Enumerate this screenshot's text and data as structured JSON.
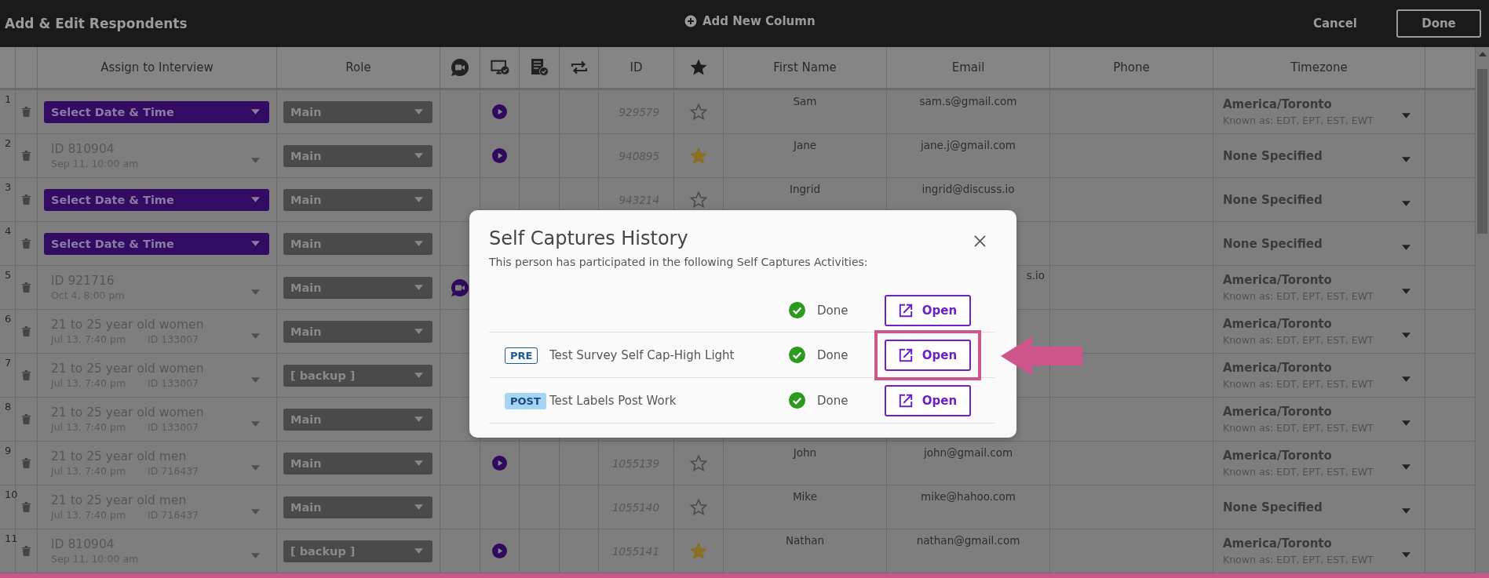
{
  "header": {
    "title": "Add & Edit Respondents",
    "add_column": "Add New Column",
    "cancel": "Cancel",
    "done": "Done"
  },
  "columns": [
    "Assign to Interview",
    "Role",
    "ID",
    "First Name",
    "Email",
    "Phone",
    "Timezone"
  ],
  "rows": [
    {
      "number": "1",
      "assign": {
        "kind": "select",
        "label": "Select Date & Time"
      },
      "role": "Main",
      "play": true,
      "id": "929579",
      "starred": false,
      "first_name": "Sam",
      "email": "sam.s@gmail.com",
      "timezone": {
        "name": "America/Toronto",
        "known_as": "Known as: EDT, EPT, EST, EWT"
      }
    },
    {
      "number": "2",
      "assign": {
        "kind": "assigned",
        "title": "ID 810904",
        "date": "Sep 11, 10:00 am"
      },
      "role": "Main",
      "play": true,
      "id": "940895",
      "starred": true,
      "first_name": "Jane",
      "email": "jane.j@gmail.com",
      "timezone": {
        "name": "None Specified"
      }
    },
    {
      "number": "3",
      "assign": {
        "kind": "select",
        "label": "Select Date & Time"
      },
      "role": "Main",
      "play": false,
      "id": "943214",
      "starred": false,
      "first_name": "Ingrid",
      "email": "ingrid@discuss.io",
      "timezone": {
        "name": "None Specified"
      }
    },
    {
      "number": "4",
      "assign": {
        "kind": "select",
        "label": "Select Date & Time"
      },
      "role": "Main",
      "play": false,
      "timezone": {
        "name": "None Specified"
      }
    },
    {
      "number": "5",
      "assign": {
        "kind": "assigned",
        "title": "ID 921716",
        "date": "Oct 4, 8:00 pm"
      },
      "role": "Main",
      "chat": true,
      "email": "s.io",
      "email_cut": true,
      "timezone": {
        "name": "America/Toronto",
        "known_as": "Known as: EDT, EPT, EST, EWT"
      }
    },
    {
      "number": "6",
      "assign": {
        "kind": "assigned",
        "title": "21 to 25 year old women",
        "date": "Jul 13, 7:40 pm",
        "ref": "ID 133007"
      },
      "role": "Main",
      "timezone": {
        "name": "America/Toronto",
        "known_as": "Known as: EDT, EPT, EST, EWT"
      }
    },
    {
      "number": "7",
      "assign": {
        "kind": "assigned",
        "title": "21 to 25 year old women",
        "date": "Jul 13, 7:40 pm",
        "ref": "ID 133007"
      },
      "role": "[ backup ]",
      "timezone": {
        "name": "America/Toronto",
        "known_as": "Known as: EDT, EPT, EST, EWT"
      }
    },
    {
      "number": "8",
      "assign": {
        "kind": "assigned",
        "title": "21 to 25 year old women",
        "date": "Jul 13, 7:40 pm",
        "ref": "ID 133007"
      },
      "role": "Main",
      "timezone": {
        "name": "America/Toronto",
        "known_as": "Known as: EDT, EPT, EST, EWT"
      }
    },
    {
      "number": "9",
      "assign": {
        "kind": "assigned",
        "title": "21 to 25 year old men",
        "date": "Jul 13, 7:40 pm",
        "ref": "ID 716437"
      },
      "role": "Main",
      "play": true,
      "id": "1055139",
      "starred": false,
      "first_name": "John",
      "email": "john@gmail.com",
      "timezone": {
        "name": "America/Toronto",
        "known_as": "Known as: EDT, EPT, EST, EWT"
      }
    },
    {
      "number": "10",
      "assign": {
        "kind": "assigned",
        "title": "21 to 25 year old men",
        "date": "Jul 13, 7:40 pm",
        "ref": "ID 716437"
      },
      "role": "Main",
      "play": false,
      "id": "1055140",
      "starred": false,
      "first_name": "Mike",
      "email": "mike@hahoo.com",
      "timezone": {
        "name": "None Specified"
      }
    },
    {
      "number": "11",
      "assign": {
        "kind": "assigned",
        "title": "ID 810904",
        "date": "Sep 11, 10:00 am"
      },
      "role": "[ backup ]",
      "play": true,
      "id": "1055141",
      "starred": true,
      "first_name": "Nathan",
      "email": "nathan@gmail.com",
      "timezone": {
        "name": "America/Toronto",
        "known_as": "Known as: EDT, EPT, EST, EWT"
      }
    }
  ],
  "dialog": {
    "title": "Self Captures History",
    "subtitle": "This person has participated in the following Self Captures Activities:",
    "activities": [
      {
        "status": "Done",
        "button": "Open",
        "highlighted": false
      },
      {
        "tag": {
          "kind": "pre",
          "text": "PRE"
        },
        "name": "Test Survey Self Cap-High Light",
        "status": "Done",
        "button": "Open",
        "highlighted": true
      },
      {
        "tag": {
          "kind": "post",
          "text": "POST"
        },
        "name": "Test Labels Post Work",
        "status": "Done",
        "button": "Open",
        "highlighted": false
      }
    ]
  }
}
